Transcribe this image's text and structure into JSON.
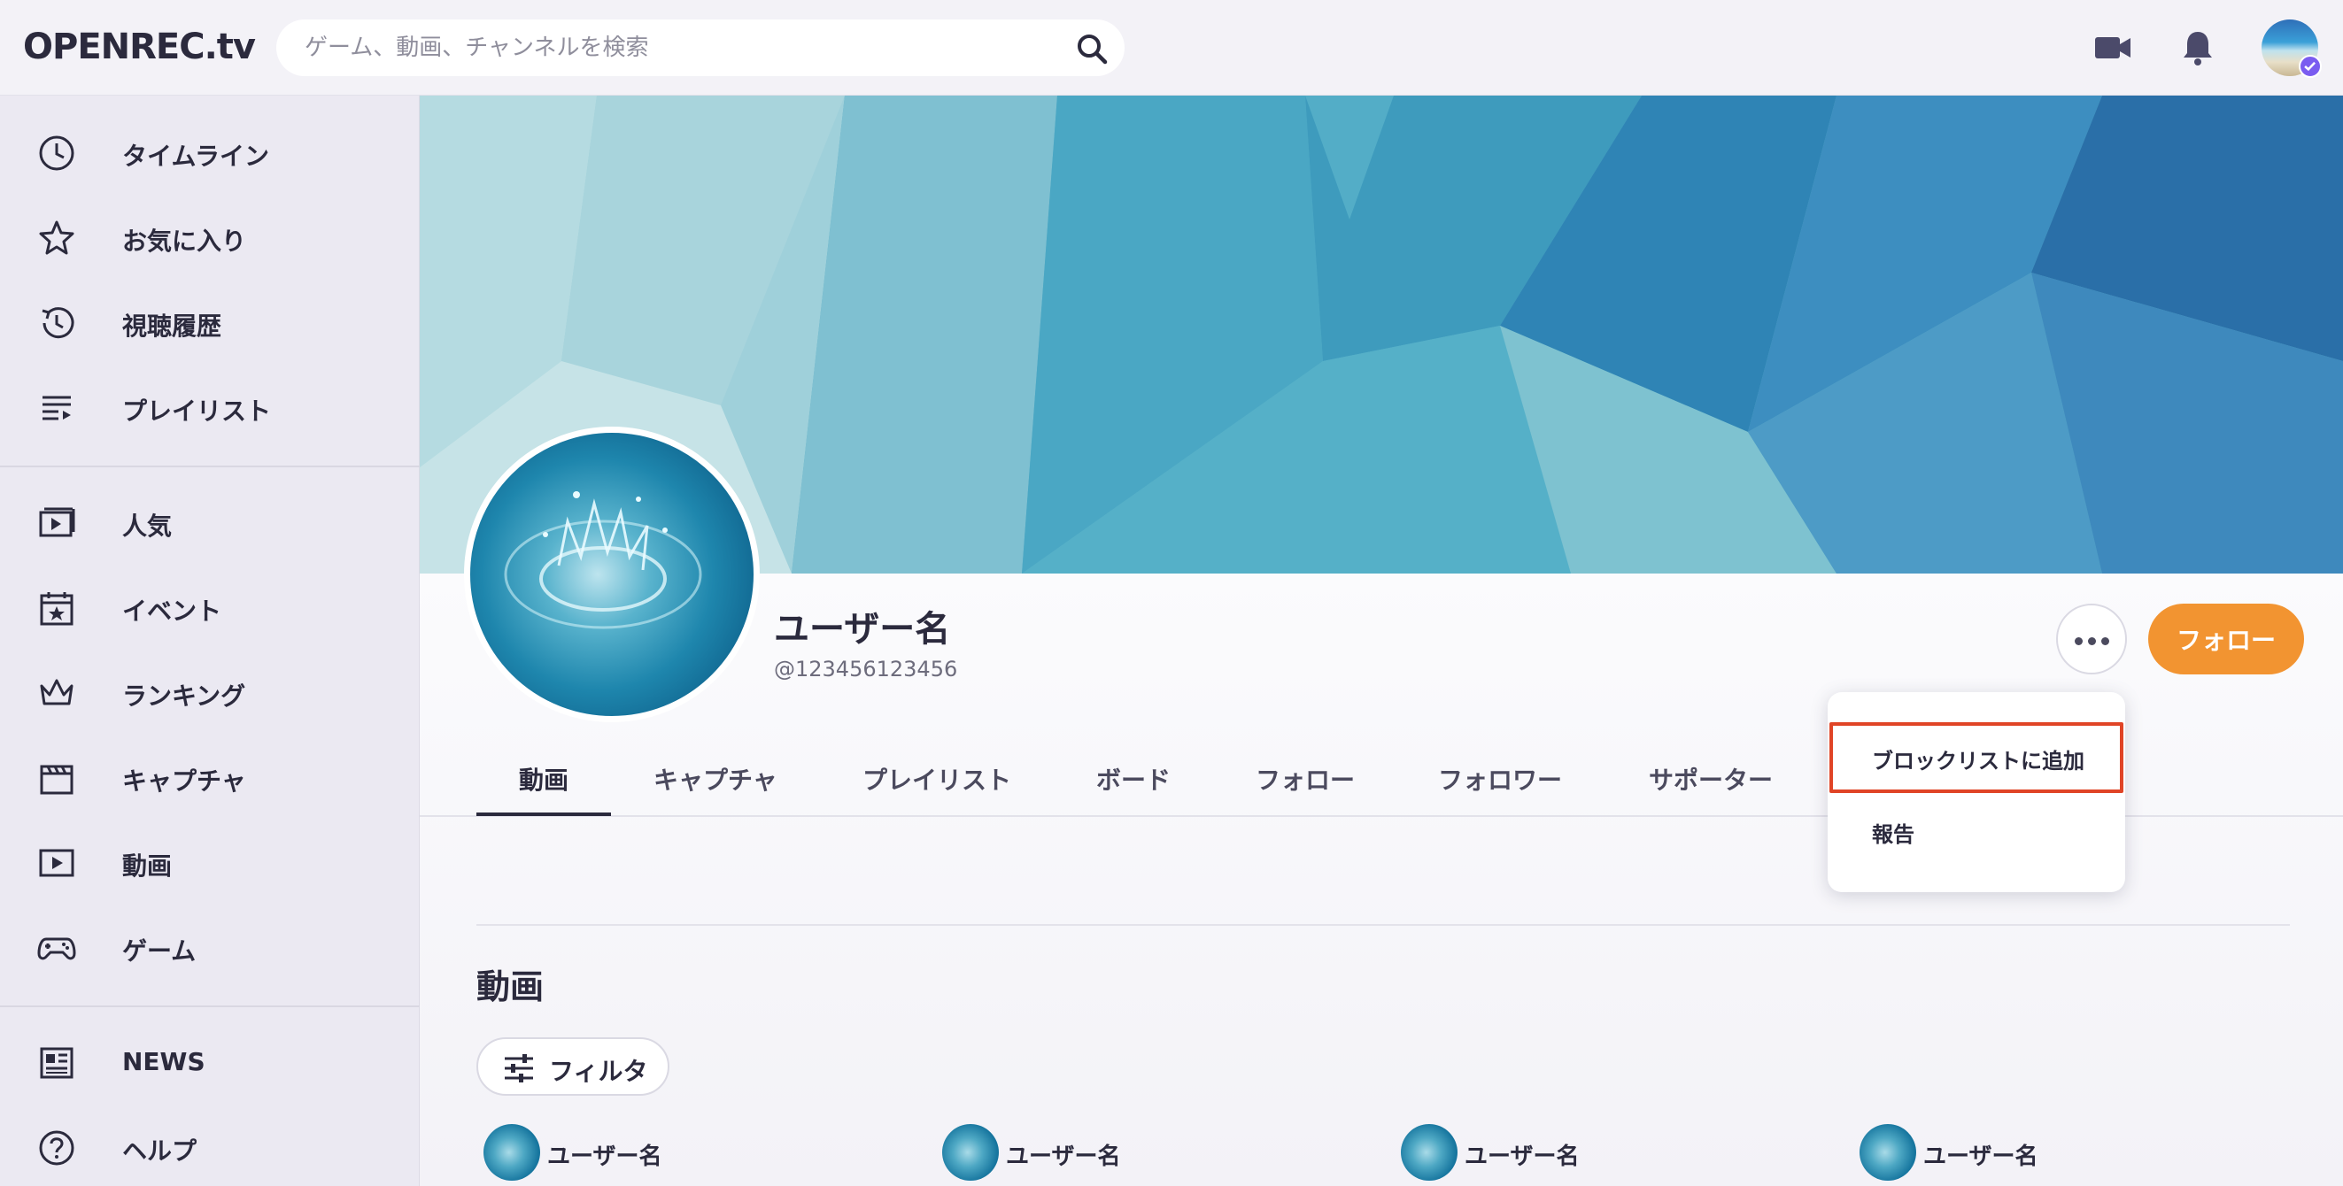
{
  "header": {
    "logo": "OPENREC.tv",
    "search_placeholder": "ゲーム、動画、チャンネルを検索",
    "icons": [
      "video-camera-icon",
      "bell-icon"
    ]
  },
  "sidebar": {
    "items": [
      {
        "label": "タイムライン",
        "icon": "clock-icon"
      },
      {
        "label": "お気に入り",
        "icon": "star-icon"
      },
      {
        "label": "視聴履歴",
        "icon": "history-icon"
      },
      {
        "label": "プレイリスト",
        "icon": "playlist-icon"
      },
      {
        "label": "人気",
        "icon": "popular-icon"
      },
      {
        "label": "イベント",
        "icon": "calendar-icon"
      },
      {
        "label": "ランキング",
        "icon": "crown-icon"
      },
      {
        "label": "キャプチャ",
        "icon": "clapperboard-icon"
      },
      {
        "label": "動画",
        "icon": "video-play-icon"
      },
      {
        "label": "ゲーム",
        "icon": "gamepad-icon"
      },
      {
        "label": "NEWS",
        "icon": "news-icon"
      },
      {
        "label": "ヘルプ",
        "icon": "help-icon"
      }
    ]
  },
  "profile": {
    "name": "ユーザー名",
    "handle": "@123456123456",
    "follow_label": "フォロー"
  },
  "tabs": [
    {
      "label": "動画",
      "active": true
    },
    {
      "label": "キャプチャ"
    },
    {
      "label": "プレイリスト"
    },
    {
      "label": "ボード"
    },
    {
      "label": "フォロー"
    },
    {
      "label": "フォロワー"
    },
    {
      "label": "サポーター"
    }
  ],
  "dropdown": {
    "items": [
      {
        "label": "ブロックリストに追加",
        "highlighted": true
      },
      {
        "label": "報告"
      }
    ]
  },
  "content": {
    "section_title": "動画",
    "filter_label": "フィルタ",
    "cards": [
      {
        "user": "ユーザー名"
      },
      {
        "user": "ユーザー名"
      },
      {
        "user": "ユーザー名"
      },
      {
        "user": "ユーザー名"
      }
    ]
  },
  "colors": {
    "accent": "#f29431",
    "highlight_border": "#e04426",
    "text": "#2b2a3d"
  }
}
